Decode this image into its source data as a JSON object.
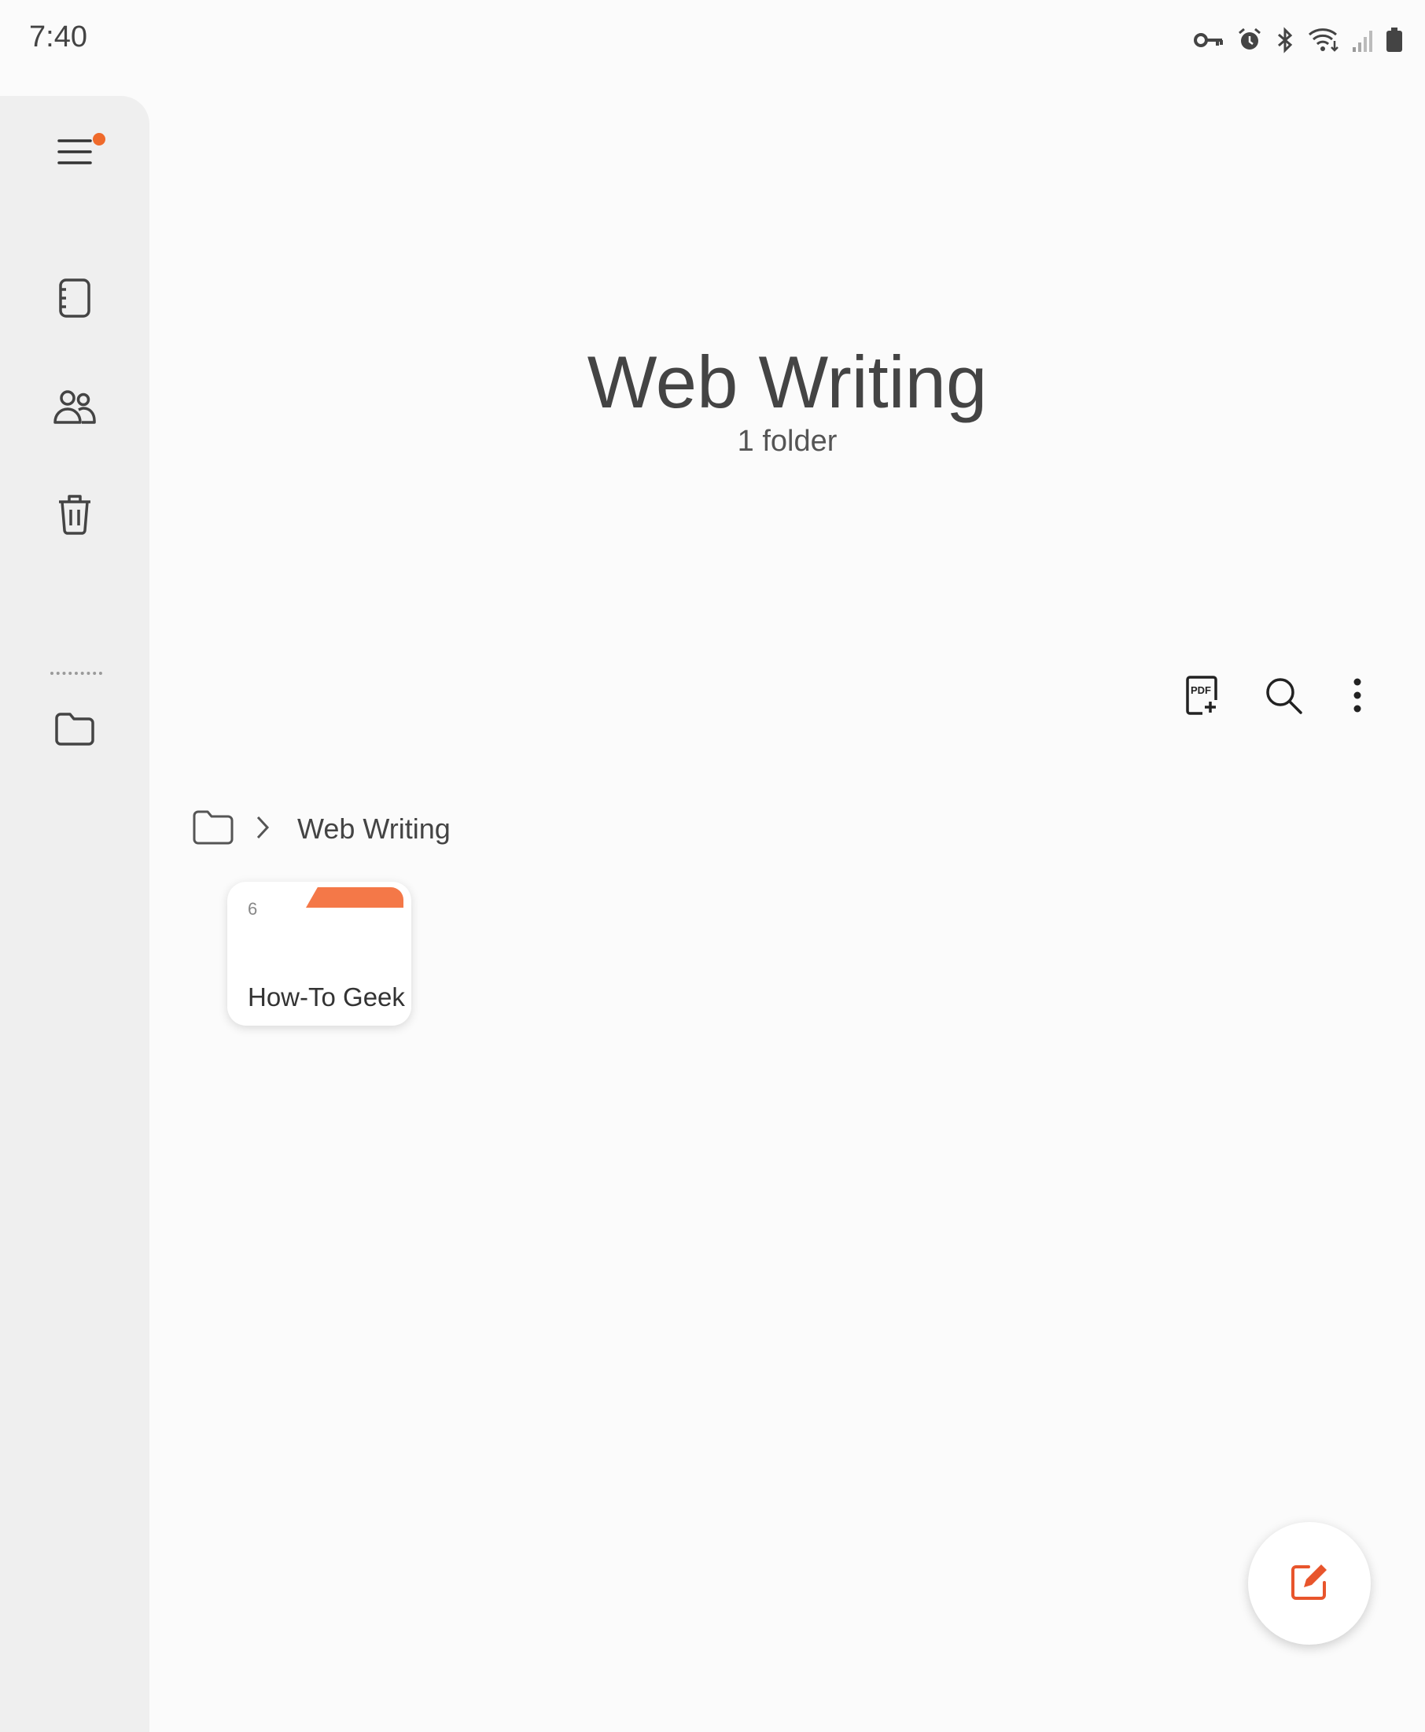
{
  "status_bar": {
    "time": "7:40",
    "icons": [
      "vpn-key-icon",
      "alarm-icon",
      "bluetooth-icon",
      "wifi-icon",
      "signal-icon",
      "battery-icon"
    ]
  },
  "rail": {
    "items": [
      {
        "name": "menu-icon",
        "has_badge": true
      },
      {
        "name": "notes-icon"
      },
      {
        "name": "shared-notebooks-icon"
      },
      {
        "name": "trash-icon"
      },
      {
        "name": "folder-icon"
      }
    ]
  },
  "header": {
    "title": "Web Writing",
    "subtitle": "1 folder"
  },
  "toolbar": {
    "icons": [
      "pdf-import-icon",
      "search-icon",
      "more-options-icon"
    ]
  },
  "breadcrumb": {
    "root_icon": "folder-icon",
    "current": "Web Writing"
  },
  "folders": [
    {
      "count": "6",
      "name": "How-To Geek",
      "color": "#f47848"
    }
  ],
  "fab": {
    "icon": "compose-note-icon",
    "color": "#e8552c"
  },
  "colors": {
    "accent": "#ef6a2b",
    "rail_bg": "#efefef",
    "page_bg": "#fbfbfb"
  }
}
